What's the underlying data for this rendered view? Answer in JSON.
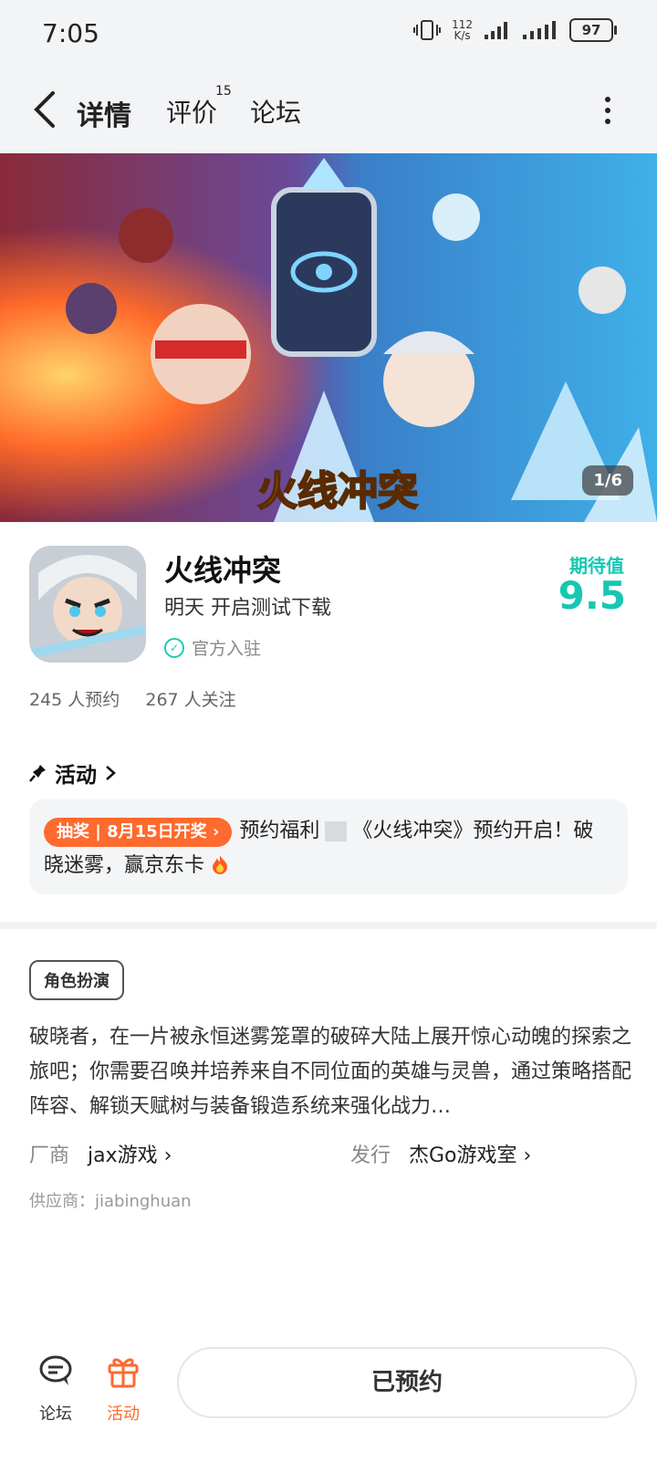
{
  "status": {
    "time": "7:05",
    "net_speed": "112",
    "net_unit": "K/s",
    "battery": "97"
  },
  "nav": {
    "tabs": [
      {
        "label": "详情"
      },
      {
        "label": "评价"
      },
      {
        "label": "论坛"
      }
    ],
    "review_count": "15"
  },
  "banner": {
    "page_indicator": "1/6",
    "logo_text": "火线冲突"
  },
  "app": {
    "title": "火线冲突",
    "subtitle": "明天 开启测试下载",
    "official": "官方入驻",
    "expect_label": "期待值",
    "expect_value": "9.5"
  },
  "stats": {
    "reservations": "245 人预约",
    "follows": "267 人关注"
  },
  "activity": {
    "title": "活动",
    "pill": "抽奖 | 8月15日开奖",
    "line_a": "预约福利",
    "line_b": "《火线冲突》预约开启！破晓迷雾，赢京东卡"
  },
  "detail": {
    "genre": "角色扮演",
    "description": "破晓者，在一片被永恒迷雾笼罩的破碎大陆上展开惊心动魄的探索之旅吧；你需要召唤并培养来自不同位面的英雄与灵兽，通过策略搭配阵容、解锁天赋树与装备锻造系统来强化战力…",
    "developer_label": "厂商",
    "developer": "jax游戏",
    "publisher_label": "发行",
    "publisher": "杰Go游戏室",
    "supplier": "供应商：jiabinghuan"
  },
  "bottom": {
    "forum": "论坛",
    "activity": "活动",
    "reserve_button": "已预约"
  },
  "colors": {
    "accent": "#1fd6c1",
    "orange": "#ff6a2e"
  }
}
